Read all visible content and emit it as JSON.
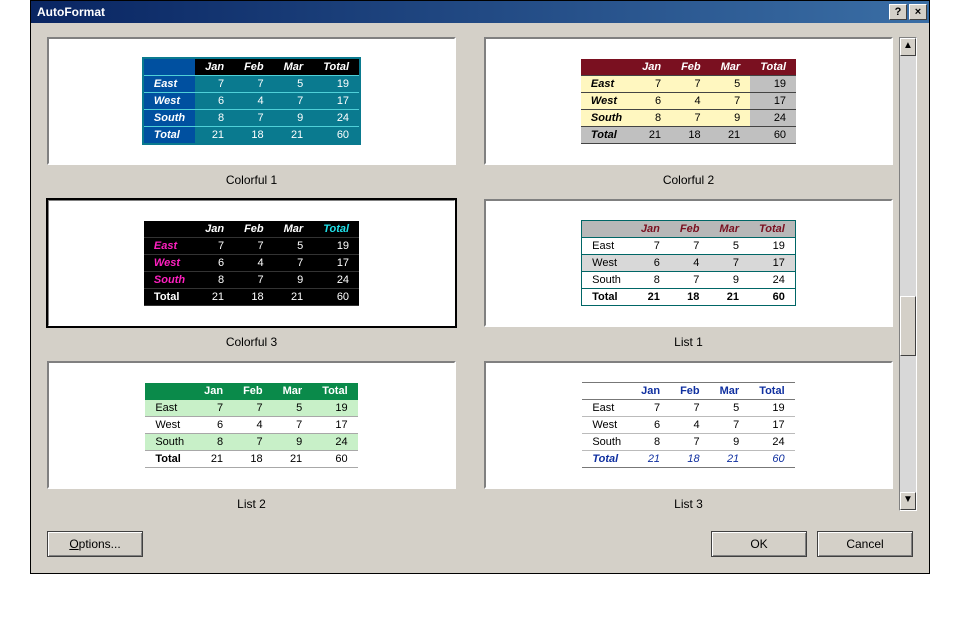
{
  "window": {
    "title": "AutoFormat",
    "help_symbol": "?",
    "close_symbol": "×"
  },
  "scroll": {
    "up": "▲",
    "down": "▼"
  },
  "buttons": {
    "options_prefix": "O",
    "options_rest": "ptions...",
    "ok": "OK",
    "cancel": "Cancel"
  },
  "table": {
    "cols": [
      "Jan",
      "Feb",
      "Mar",
      "Total"
    ],
    "rows": [
      {
        "name": "East",
        "v": [
          7,
          7,
          5,
          19
        ]
      },
      {
        "name": "West",
        "v": [
          6,
          4,
          7,
          17
        ]
      },
      {
        "name": "South",
        "v": [
          8,
          7,
          9,
          24
        ]
      }
    ],
    "total": {
      "name": "Total",
      "v": [
        21,
        18,
        21,
        60
      ]
    }
  },
  "samples": [
    {
      "id": "colorful1",
      "label": "Colorful 1",
      "cls": "c1",
      "selected": false
    },
    {
      "id": "colorful2",
      "label": "Colorful 2",
      "cls": "c2",
      "selected": false
    },
    {
      "id": "colorful3",
      "label": "Colorful 3",
      "cls": "c3",
      "selected": true
    },
    {
      "id": "list1",
      "label": "List 1",
      "cls": "l1",
      "selected": false
    },
    {
      "id": "list2",
      "label": "List 2",
      "cls": "l2",
      "selected": false
    },
    {
      "id": "list3",
      "label": "List 3",
      "cls": "l3",
      "selected": false
    }
  ]
}
